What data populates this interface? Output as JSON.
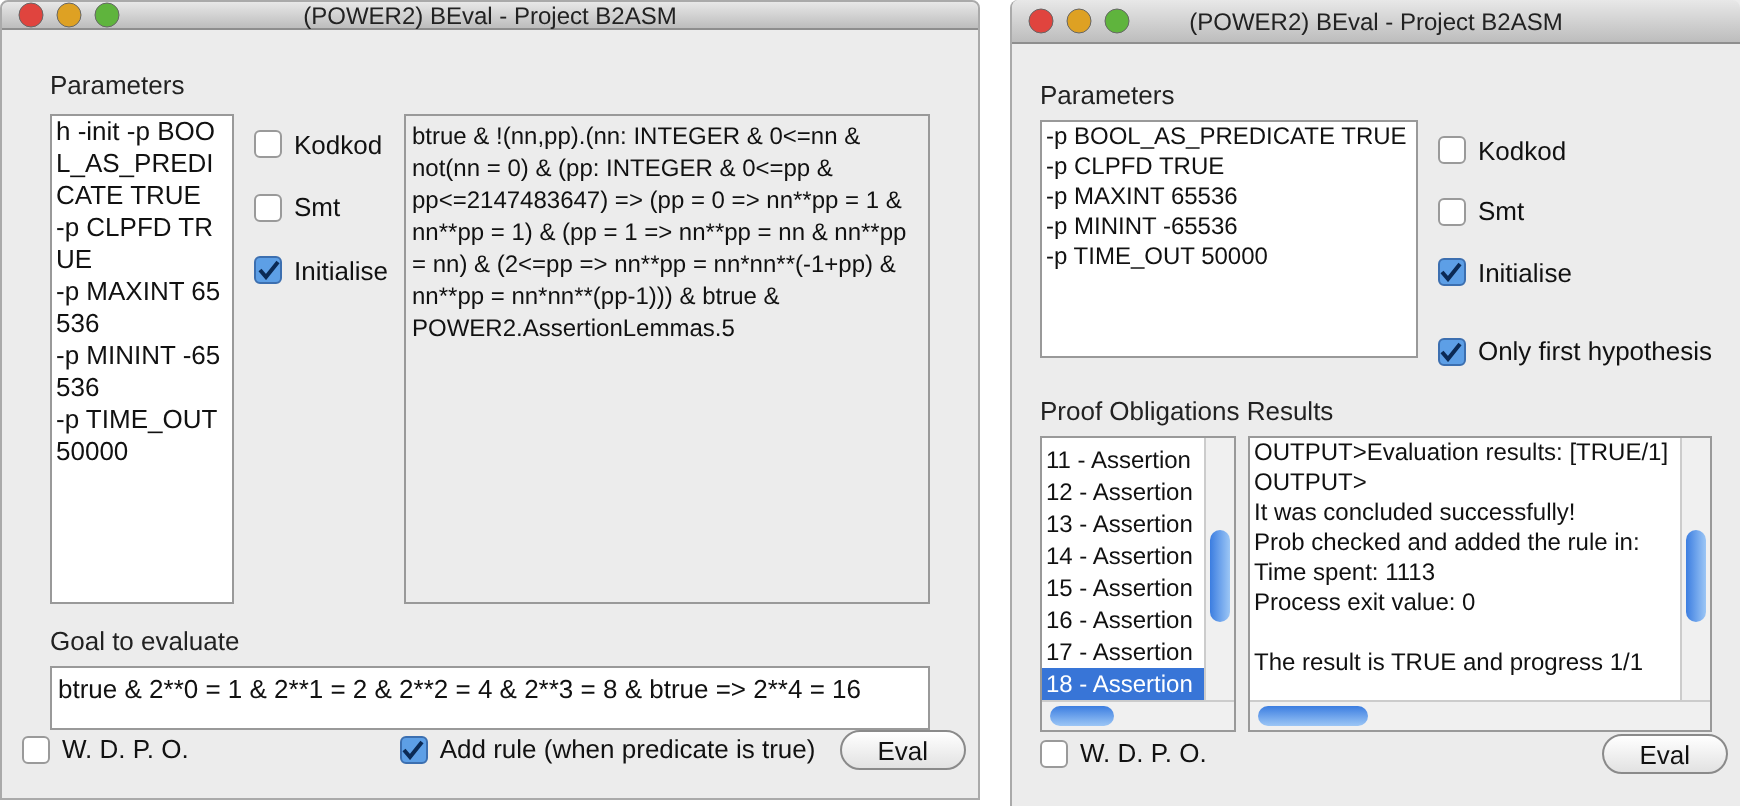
{
  "windows": [
    {
      "kind": "goal-editor",
      "title": "(POWER2) BEval - Project B2ASM",
      "parameters_label": "Parameters",
      "parameters": [
        "h -init -p BOOL_AS_PREDICATE TRUE",
        "-p CLPFD TRUE",
        "-p MAXINT 65536",
        "-p MININT -65536",
        "-p TIME_OUT 50000"
      ],
      "options": [
        {
          "label": "Kodkod",
          "checked": false
        },
        {
          "label": "Smt",
          "checked": false
        },
        {
          "label": "Initialise",
          "checked": true
        }
      ],
      "hypothesis_text": "btrue & !(nn,pp).(nn: INTEGER & 0<=nn & not(nn = 0) & (pp: INTEGER & 0<=pp & pp<=2147483647) => (pp = 0 => nn**pp = 1 & nn**pp = 1) & (pp = 1 => nn**pp = nn & nn**pp = nn) & (2<=pp => nn**pp = nn*nn**(-1+pp) & nn**pp = nn*nn**(pp-1))) & btrue & POWER2.AssertionLemmas.5",
      "goal_label": "Goal to evaluate",
      "goal": "btrue & 2**0 = 1 & 2**1 = 2 & 2**2 = 4 & 2**3 = 8 & btrue => 2**4 = 16",
      "wdpo": {
        "label": "W. D. P. O.",
        "checked": false
      },
      "add_rule": {
        "label": "Add rule (when predicate is true)",
        "checked": true
      },
      "eval_button": "Eval"
    },
    {
      "kind": "results",
      "title": "(POWER2) BEval - Project B2ASM",
      "parameters_label": "Parameters",
      "parameters": [
        "-p BOOL_AS_PREDICATE TRUE",
        "-p CLPFD TRUE",
        "-p MAXINT 65536",
        "-p MININT -65536",
        "-p TIME_OUT 50000"
      ],
      "options": [
        {
          "label": "Kodkod",
          "checked": false
        },
        {
          "label": "Smt",
          "checked": false
        },
        {
          "label": "Initialise",
          "checked": true
        },
        {
          "label": "Only first hypothesis",
          "checked": true
        }
      ],
      "results_label": "Proof Obligations Results",
      "results": [
        {
          "label": "11 - Assertion",
          "selected": false
        },
        {
          "label": "12 - Assertion",
          "selected": false
        },
        {
          "label": "13 - Assertion",
          "selected": false
        },
        {
          "label": "14 - Assertion",
          "selected": false
        },
        {
          "label": "15 - Assertion",
          "selected": false
        },
        {
          "label": "16 - Assertion",
          "selected": false
        },
        {
          "label": "17 - Assertion",
          "selected": false
        },
        {
          "label": "18 - Assertion",
          "selected": true
        }
      ],
      "output_blocks": [
        {
          "lines": [
            "OUTPUT>Evaluation results: [TRUE/1]",
            "OUTPUT>",
            "It was concluded successfully!",
            "Prob checked and added the rule in:",
            "Time spent: 1113",
            "Process exit value: 0"
          ]
        },
        {
          "lines": [
            "The result is TRUE and progress 1/1"
          ]
        }
      ],
      "wdpo": {
        "label": "W. D. P. O.",
        "checked": false
      },
      "eval_button": "Eval"
    }
  ]
}
